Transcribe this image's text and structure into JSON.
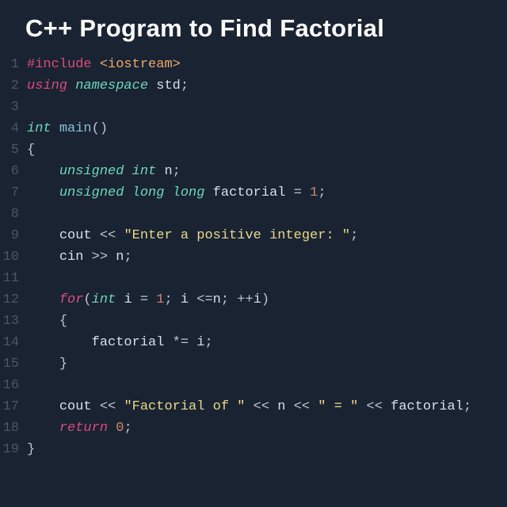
{
  "title": "C++ Program to Find Factorial",
  "gutter": [
    "1",
    "2",
    "3",
    "4",
    "5",
    "6",
    "7",
    "8",
    "9",
    "10",
    "11",
    "12",
    "13",
    "14",
    "15",
    "16",
    "17",
    "18",
    "19"
  ],
  "code": {
    "l1": {
      "a": "#include",
      "b": "<iostream>"
    },
    "l2": {
      "a": "using",
      "b": "namespace",
      "c": "std",
      "d": ";"
    },
    "l4": {
      "a": "int",
      "b": "main",
      "c": "()"
    },
    "l5": {
      "a": "{"
    },
    "l6": {
      "a": "unsigned",
      "b": "int",
      "c": "n",
      "d": ";"
    },
    "l7": {
      "a": "unsigned",
      "b": "long",
      "c": "long",
      "d": "factorial",
      "e": "=",
      "f": "1",
      "g": ";"
    },
    "l9": {
      "a": "cout",
      "b": "<<",
      "c": "\"Enter a positive integer: \"",
      "d": ";"
    },
    "l10": {
      "a": "cin",
      "b": ">>",
      "c": "n",
      "d": ";"
    },
    "l12": {
      "a": "for",
      "b": "(",
      "c": "int",
      "d": "i",
      "e": "=",
      "f": "1",
      "g": ";",
      "h": "i",
      "i": "<=",
      "j": "n",
      "k": ";",
      "l": "++",
      "m": "i",
      "n": ")"
    },
    "l13": {
      "a": "{"
    },
    "l14": {
      "a": "factorial",
      "b": "*=",
      "c": "i",
      "d": ";"
    },
    "l15": {
      "a": "}"
    },
    "l17": {
      "a": "cout",
      "b": "<<",
      "c": "\"Factorial of \"",
      "d": "<<",
      "e": "n",
      "f": "<<",
      "g": "\" = \"",
      "h": "<<",
      "i": "factorial",
      "j": ";"
    },
    "l18": {
      "a": "return",
      "b": "0",
      "c": ";"
    },
    "l19": {
      "a": "}"
    }
  }
}
